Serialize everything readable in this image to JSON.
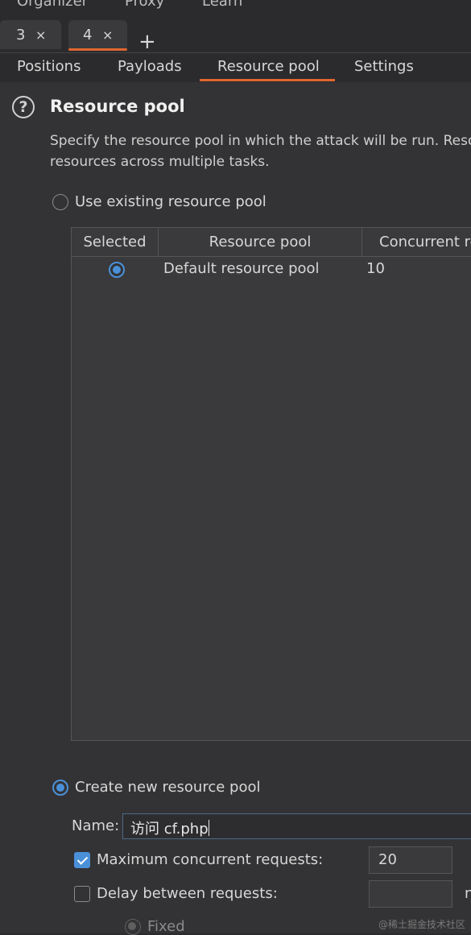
{
  "top_nav": {
    "items": [
      "Organizer",
      "Proxy",
      "Learn"
    ]
  },
  "request_tabs": [
    {
      "label": "3",
      "close": "×"
    },
    {
      "label": "4",
      "close": "×"
    }
  ],
  "add_tab_label": "+",
  "sub_tabs": [
    "Positions",
    "Payloads",
    "Resource pool",
    "Settings"
  ],
  "active_sub_tab": "Resource pool",
  "section": {
    "help_glyph": "?",
    "title": "Resource pool",
    "description_line1": "Specify the resource pool in which the attack will be run. Reso",
    "description_line2": "resources across multiple tasks."
  },
  "use_existing_label": "Use existing resource pool",
  "table": {
    "headers": [
      "Selected",
      "Resource pool",
      "Concurrent re"
    ],
    "rows": [
      {
        "selected": true,
        "name": "Default resource pool",
        "concurrent": "10"
      }
    ]
  },
  "create_new_label": "Create new resource pool",
  "name_label": "Name:",
  "name_value": "访问 cf.php",
  "max_concurrent": {
    "label": "Maximum concurrent requests:",
    "checked": true,
    "value": "20"
  },
  "delay": {
    "label": "Delay between requests:",
    "checked": false,
    "value": "",
    "unit_fragment": "n"
  },
  "fixed_label": "Fixed",
  "watermark": "@稀土掘金技术社区",
  "colors": {
    "accent": "#e0672f",
    "selection": "#4a90d9",
    "background": "#333335"
  }
}
